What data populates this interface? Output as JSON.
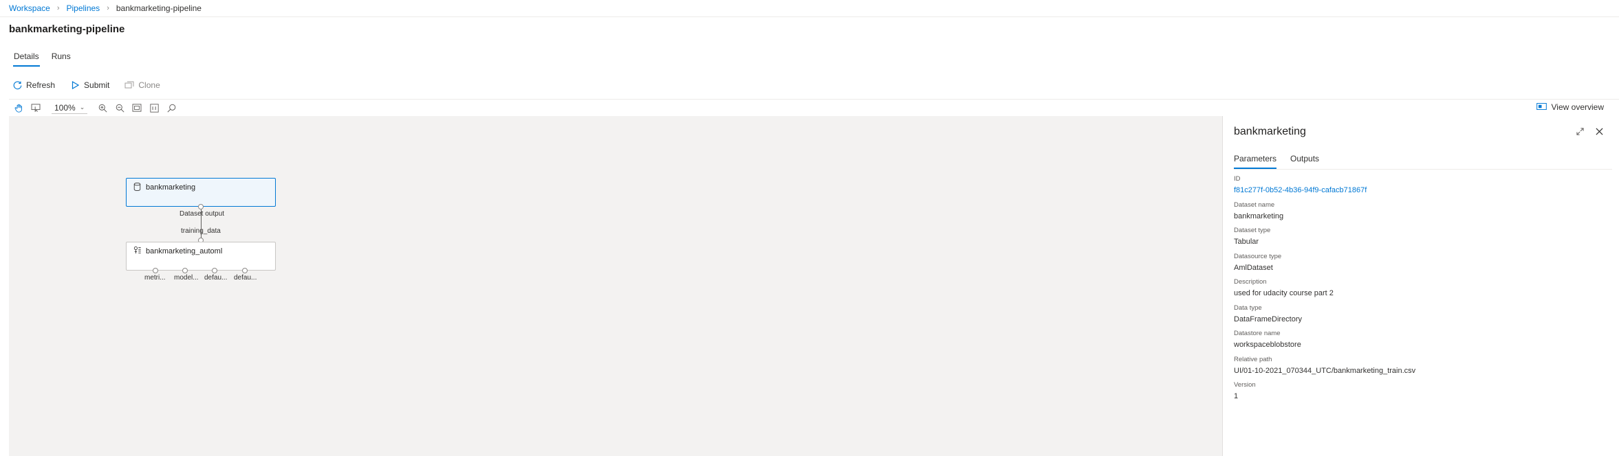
{
  "breadcrumb": {
    "items": [
      "Workspace",
      "Pipelines"
    ],
    "current": "bankmarketing-pipeline"
  },
  "page": {
    "title": "bankmarketing-pipeline"
  },
  "tabs": [
    {
      "label": "Details",
      "active": true
    },
    {
      "label": "Runs",
      "active": false
    }
  ],
  "commands": {
    "refresh": "Refresh",
    "submit": "Submit",
    "clone": "Clone"
  },
  "canvas_toolbar": {
    "zoom": "100%",
    "view_overview": "View overview",
    "icons": [
      "pan-hand-icon",
      "select-icon",
      "zoom-in-icon",
      "zoom-out-icon",
      "fit-screen-icon",
      "actual-size-icon",
      "search-icon"
    ]
  },
  "graph": {
    "dataset_node": {
      "label": "bankmarketing",
      "output_label": "Dataset output"
    },
    "automl_node": {
      "label": "bankmarketing_automl",
      "input_label": "training_data"
    },
    "output_ports": [
      "metri...",
      "model...",
      "defau...",
      "defau..."
    ]
  },
  "panel": {
    "title": "bankmarketing",
    "tabs": [
      {
        "label": "Parameters",
        "active": true
      },
      {
        "label": "Outputs",
        "active": false
      }
    ],
    "props": [
      {
        "label": "ID",
        "value": "f81c277f-0b52-4b36-94f9-cafacb71867f",
        "link": true
      },
      {
        "label": "Dataset name",
        "value": "bankmarketing"
      },
      {
        "label": "Dataset type",
        "value": "Tabular"
      },
      {
        "label": "Datasource type",
        "value": "AmlDataset"
      },
      {
        "label": "Description",
        "value": "used for udacity course part 2"
      },
      {
        "label": "Data type",
        "value": "DataFrameDirectory"
      },
      {
        "label": "Datastore name",
        "value": "workspaceblobstore"
      },
      {
        "label": "Relative path",
        "value": "UI/01-10-2021_070344_UTC/bankmarketing_train.csv"
      },
      {
        "label": "Version",
        "value": "1"
      }
    ]
  },
  "colors": {
    "accent": "#0078d4",
    "canvas_bg": "#f3f2f1",
    "selected_node_bg": "#eff6fc"
  }
}
